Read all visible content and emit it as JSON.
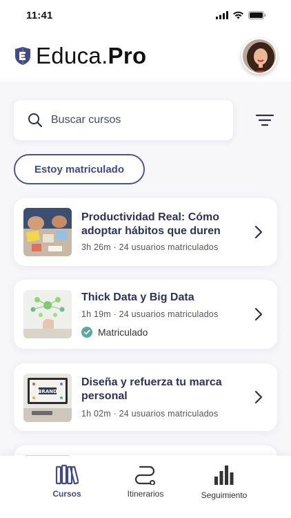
{
  "status_bar": {
    "time": "11:41"
  },
  "header": {
    "brand_prefix": "Educa",
    "brand_dot": ".",
    "brand_suffix": "Pro"
  },
  "search": {
    "placeholder": "Buscar cursos"
  },
  "filter_chip": {
    "label": "Estoy matriculado"
  },
  "courses": [
    {
      "title": "Productividad Real: Cómo adoptar hábitos que duren",
      "duration": "3h 26m",
      "students": "24 usuarios matriculados",
      "enrolled": false
    },
    {
      "title": "Thick Data y Big Data",
      "duration": "1h 19m",
      "students": "24 usuarios matriculados",
      "enrolled": true,
      "enrolled_label": "Matriculado"
    },
    {
      "title": "Diseña y refuerza tu marca personal",
      "duration": "1h 02m",
      "students": "24 usuarios matriculados",
      "enrolled": false
    }
  ],
  "bottom_nav": [
    {
      "label": "Cursos",
      "icon": "books-icon",
      "active": true
    },
    {
      "label": "Itinerarios",
      "icon": "route-icon",
      "active": false
    },
    {
      "label": "Seguimiento",
      "icon": "bar-chart-icon",
      "active": false
    }
  ],
  "colors": {
    "accent": "#3f4a86",
    "success": "#5aa99c",
    "background": "#f7f7fa"
  }
}
